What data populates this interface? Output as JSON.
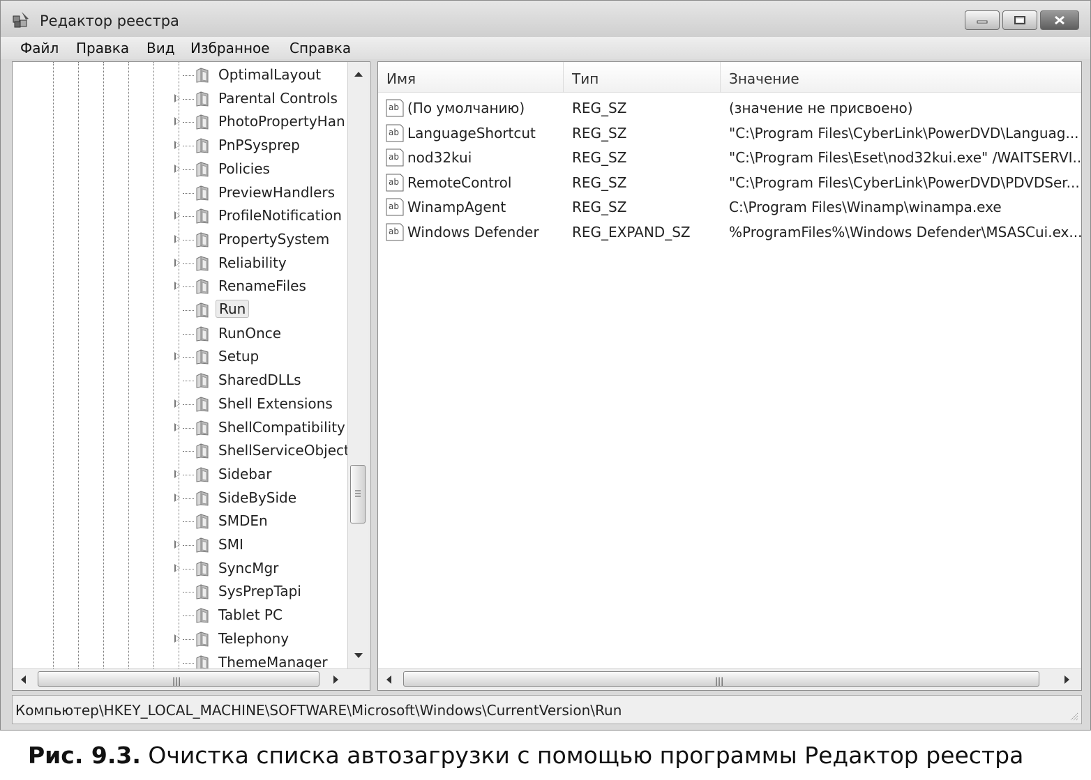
{
  "window": {
    "title": "Редактор реестра",
    "icon": "registry-editor-icon"
  },
  "menu": [
    "Файл",
    "Правка",
    "Вид",
    "Избранное",
    "Справка"
  ],
  "tree": {
    "items": [
      {
        "label": "OptimalLayout",
        "expandable": false
      },
      {
        "label": "Parental Controls",
        "expandable": true
      },
      {
        "label": "PhotoPropertyHan",
        "expandable": true
      },
      {
        "label": "PnPSysprep",
        "expandable": true
      },
      {
        "label": "Policies",
        "expandable": true
      },
      {
        "label": "PreviewHandlers",
        "expandable": false
      },
      {
        "label": "ProfileNotification",
        "expandable": true
      },
      {
        "label": "PropertySystem",
        "expandable": true
      },
      {
        "label": "Reliability",
        "expandable": true
      },
      {
        "label": "RenameFiles",
        "expandable": true
      },
      {
        "label": "Run",
        "expandable": false,
        "selected": true
      },
      {
        "label": "RunOnce",
        "expandable": false
      },
      {
        "label": "Setup",
        "expandable": true
      },
      {
        "label": "SharedDLLs",
        "expandable": false
      },
      {
        "label": "Shell Extensions",
        "expandable": true
      },
      {
        "label": "ShellCompatibility",
        "expandable": true
      },
      {
        "label": "ShellServiceObject",
        "expandable": false
      },
      {
        "label": "Sidebar",
        "expandable": true
      },
      {
        "label": "SideBySide",
        "expandable": true
      },
      {
        "label": "SMDEn",
        "expandable": false
      },
      {
        "label": "SMI",
        "expandable": true
      },
      {
        "label": "SyncMgr",
        "expandable": true
      },
      {
        "label": "SysPrepTapi",
        "expandable": false
      },
      {
        "label": "Tablet PC",
        "expandable": false
      },
      {
        "label": "Telephony",
        "expandable": true
      },
      {
        "label": "ThemeManager",
        "expandable": false
      }
    ]
  },
  "values": {
    "columns": [
      "Имя",
      "Тип",
      "Значение"
    ],
    "rows": [
      {
        "name": "(По умолчанию)",
        "type": "REG_SZ",
        "data": "(значение не присвоено)"
      },
      {
        "name": "LanguageShortcut",
        "type": "REG_SZ",
        "data": "\"C:\\Program Files\\CyberLink\\PowerDVD\\Languag..."
      },
      {
        "name": "nod32kui",
        "type": "REG_SZ",
        "data": "\"C:\\Program Files\\Eset\\nod32kui.exe\" /WAITSERVI..."
      },
      {
        "name": "RemoteControl",
        "type": "REG_SZ",
        "data": "\"C:\\Program Files\\CyberLink\\PowerDVD\\PDVDSer..."
      },
      {
        "name": "WinampAgent",
        "type": "REG_SZ",
        "data": "C:\\Program Files\\Winamp\\winampa.exe"
      },
      {
        "name": "Windows Defender",
        "type": "REG_EXPAND_SZ",
        "data": "%ProgramFiles%\\Windows Defender\\MSASCui.ex..."
      }
    ]
  },
  "status": {
    "path": "Компьютер\\HKEY_LOCAL_MACHINE\\SOFTWARE\\Microsoft\\Windows\\CurrentVersion\\Run"
  },
  "caption": {
    "label": "Рис. 9.3.",
    "text": "Очистка списка автозагрузки с помощью программы Редактор реестра"
  }
}
